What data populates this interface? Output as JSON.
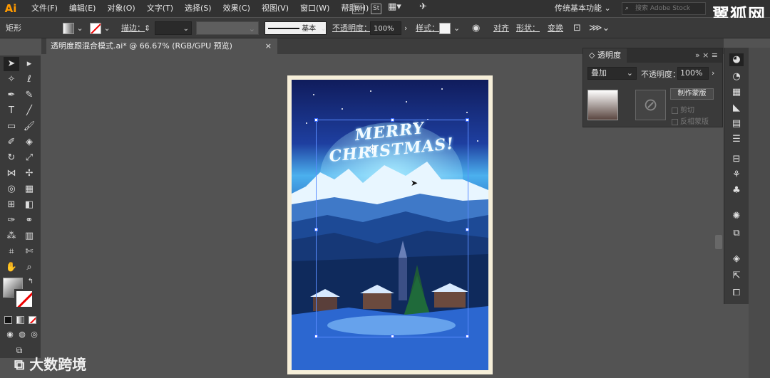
{
  "app": {
    "logo": "Ai"
  },
  "menu": [
    "文件(F)",
    "编辑(E)",
    "对象(O)",
    "文字(T)",
    "选择(S)",
    "效果(C)",
    "视图(V)",
    "窗口(W)",
    "帮助(H)"
  ],
  "menu_badges": [
    "Br",
    "St"
  ],
  "workspace": "传统基本功能",
  "search": {
    "placeholder": "搜索 Adobe Stock"
  },
  "watermark": "翼狐网",
  "control": {
    "object_type": "矩形",
    "stroke_label": "描边：",
    "stroke_value": "",
    "brush_label": "基本",
    "opacity_label": "不透明度：",
    "opacity_value": "100%",
    "style_label": "样式：",
    "align_label": "对齐",
    "shape_label": "形状：",
    "transform_label": "变换"
  },
  "document_tab": {
    "title": "透明度跟混合模式.ai* @ 66.67% (RGB/GPU 预览)",
    "close": "×"
  },
  "artwork": {
    "greeting": "MERRY CHRISTMAS!",
    "snowflake": "❄"
  },
  "transparency_panel": {
    "title": "透明度",
    "collapse": "»",
    "menu": "≡",
    "blend_mode": "叠加",
    "opacity_label": "不透明度：",
    "opacity_value": "100%",
    "make_mask_button": "制作蒙版",
    "clip_label": "剪切",
    "invert_label": "反相蒙版"
  },
  "bottom_watermark": "大数跨境",
  "colors": {
    "accent": "#ff9a00",
    "selection": "#3b6aff",
    "panel": "#3a3a3a",
    "canvas": "#535353"
  },
  "icons": {
    "toolbar": [
      "selection-icon",
      "direct-selection-icon",
      "magic-wand-icon",
      "lasso-icon",
      "pen-icon",
      "curvature-icon",
      "type-icon",
      "line-icon",
      "rectangle-icon",
      "paintbrush-icon",
      "shaper-icon",
      "eraser-icon",
      "rotate-icon",
      "scale-icon",
      "width-icon",
      "puppet-warp-icon",
      "shape-builder-icon",
      "perspective-icon",
      "mesh-icon",
      "gradient-icon",
      "eyedropper-icon",
      "blend-icon",
      "symbol-sprayer-icon",
      "graph-icon",
      "artboard-icon",
      "slice-icon",
      "hand-icon",
      "zoom-icon"
    ],
    "right_dock": [
      "color-icon",
      "color-guide-icon",
      "swatches-icon",
      "brushes-icon",
      "stroke-icon",
      "gradient-panel-icon",
      "transparency-icon",
      "artboards-icon",
      "align-icon",
      "symbols-icon",
      "appearance-icon",
      "graphic-styles-icon",
      "layers-icon",
      "export-icon",
      "links-icon"
    ]
  }
}
